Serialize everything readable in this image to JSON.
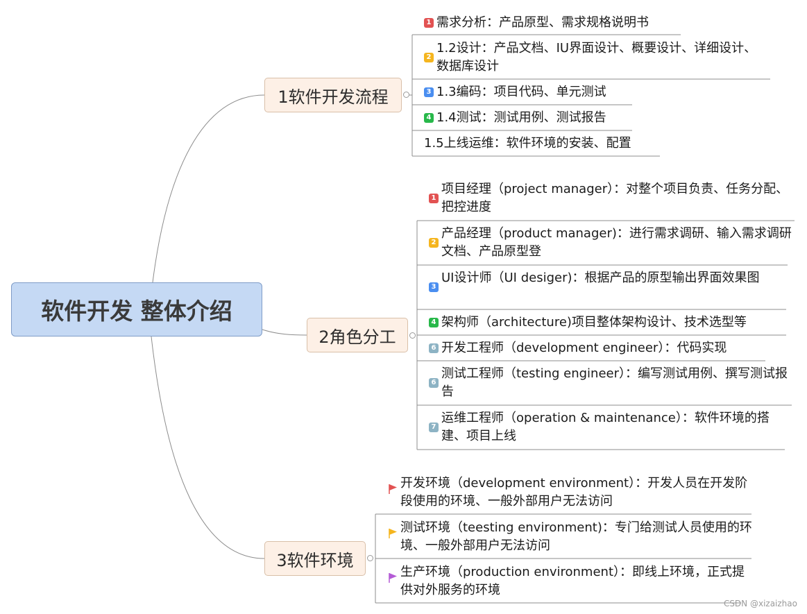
{
  "root": {
    "label": "软件开发 整体介绍"
  },
  "branches": [
    {
      "label": "1软件开发流程",
      "items": [
        {
          "badge": "1",
          "badge_color": "#e25252",
          "text": "需求分析：产品原型、需求规格说明书"
        },
        {
          "badge": "2",
          "badge_color": "#f5b51e",
          "text": "1.2设计：产品文档、IU界面设计、概要设计、详细设计、数据库设计"
        },
        {
          "badge": "3",
          "badge_color": "#4a8ef0",
          "text": "1.3编码：项目代码、单元测试"
        },
        {
          "badge": "4",
          "badge_color": "#28b84a",
          "text": "1.4测试：测试用例、测试报告"
        },
        {
          "badge": "",
          "badge_color": "",
          "text": "1.5上线运维：软件环境的安装、配置"
        }
      ]
    },
    {
      "label": "2角色分工",
      "items": [
        {
          "badge": "1",
          "badge_color": "#e25252",
          "text": "项目经理（project manager）：对整个项目负责、任务分配、把控进度"
        },
        {
          "badge": "2",
          "badge_color": "#f5b51e",
          "text": "产品经理（product manager)：进行需求调研、输入需求调研文档、产品原型登"
        },
        {
          "badge": "3",
          "badge_color": "#4a8ef0",
          "text": "UI设计师（UI desiger)：根据产品的原型输出界面效果图"
        },
        {
          "badge": "4",
          "badge_color": "#28b84a",
          "text": "架构师（architecture)项目整体架构设计、技术选型等"
        },
        {
          "badge": "6",
          "badge_color": "#8db3c4",
          "text": "开发工程师（development engineer）：代码实现"
        },
        {
          "badge": "6",
          "badge_color": "#8db3c4",
          "text": "测试工程师（testing engineer）：编写测试用例、撰写测试报告"
        },
        {
          "badge": "7",
          "badge_color": "#8db3c4",
          "text": "运维工程师（operation & maintenance）：软件环境的搭建、项目上线"
        }
      ]
    },
    {
      "label": "3软件环境",
      "items": [
        {
          "flag_color": "#e25252",
          "text": "开发环境（development environment）：开发人员在开发阶段使用的环境、一般外部用户无法访问"
        },
        {
          "flag_color": "#f5b51e",
          "text": "测试环境（teesting environment)：专门给测试人员使用的环境、一般外部用户无法访问"
        },
        {
          "flag_color": "#b45bd6",
          "text": "生产环境（production environment）：即线上环境，正式提供对外服务的环境"
        }
      ]
    }
  ],
  "watermark": "CSDN @xizaizhao"
}
